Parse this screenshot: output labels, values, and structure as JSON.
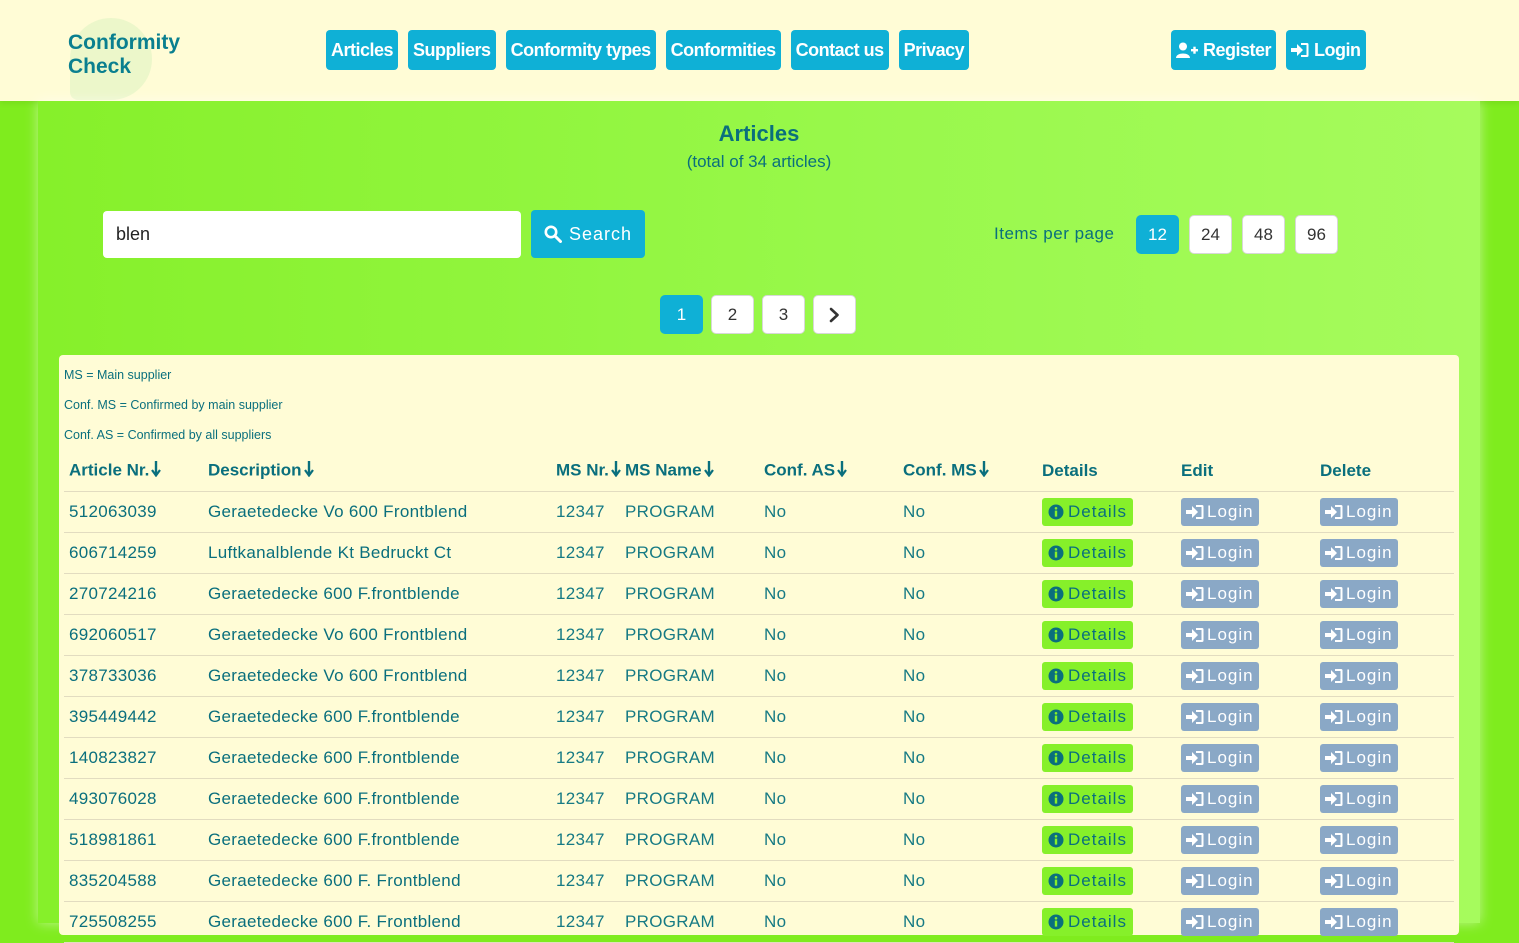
{
  "logo": {
    "line1": "Conformity",
    "line2": "Check"
  },
  "nav": [
    {
      "label": "Articles",
      "id": "articles"
    },
    {
      "label": "Suppliers",
      "id": "suppliers"
    },
    {
      "label": "Conformity types",
      "id": "conformity-types"
    },
    {
      "label": "Conformities",
      "id": "conformities"
    },
    {
      "label": "Contact us",
      "id": "contact-us"
    },
    {
      "label": "Privacy",
      "id": "privacy"
    }
  ],
  "auth": {
    "register_label": "Register",
    "register_icon": "user-plus-icon",
    "login_label": "Login",
    "login_icon": "sign-in-icon"
  },
  "page": {
    "title": "Articles",
    "subtitle": "(total of 34 articles)"
  },
  "search": {
    "value": "blen",
    "button_label": "Search",
    "icon": "search-icon"
  },
  "items_per_page": {
    "label": "Items per page",
    "options": [
      "12",
      "24",
      "48",
      "96"
    ],
    "selected": "12"
  },
  "pagination": {
    "pages": [
      "1",
      "2",
      "3"
    ],
    "current": "1",
    "next_icon": "chevron-right-icon"
  },
  "legend": [
    "MS = Main supplier",
    "Conf. MS = Confirmed by main supplier",
    "Conf. AS = Confirmed by all suppliers"
  ],
  "table": {
    "headers": [
      "Article Nr.",
      "Description",
      "MS Nr.",
      "MS Name",
      "Conf. AS",
      "Conf. MS",
      "Details",
      "Edit",
      "Delete"
    ],
    "sortable": [
      true,
      true,
      true,
      true,
      true,
      true,
      false,
      false,
      false
    ],
    "details_label": "Details",
    "details_icon": "info-circle-icon",
    "login_label": "Login",
    "rows": [
      {
        "article": "512063039",
        "description": "Geraetedecke Vo 600 Frontblend",
        "ms_nr": "12347",
        "ms_name": "PROGRAM",
        "conf_as": "No",
        "conf_ms": "No"
      },
      {
        "article": "606714259",
        "description": "Luftkanalblende Kt Bedruckt Ct",
        "ms_nr": "12347",
        "ms_name": "PROGRAM",
        "conf_as": "No",
        "conf_ms": "No"
      },
      {
        "article": "270724216",
        "description": "Geraetedecke 600 F.frontblende",
        "ms_nr": "12347",
        "ms_name": "PROGRAM",
        "conf_as": "No",
        "conf_ms": "No"
      },
      {
        "article": "692060517",
        "description": "Geraetedecke Vo 600 Frontblend",
        "ms_nr": "12347",
        "ms_name": "PROGRAM",
        "conf_as": "No",
        "conf_ms": "No"
      },
      {
        "article": "378733036",
        "description": "Geraetedecke Vo 600 Frontblend",
        "ms_nr": "12347",
        "ms_name": "PROGRAM",
        "conf_as": "No",
        "conf_ms": "No"
      },
      {
        "article": "395449442",
        "description": "Geraetedecke 600 F.frontblende",
        "ms_nr": "12347",
        "ms_name": "PROGRAM",
        "conf_as": "No",
        "conf_ms": "No"
      },
      {
        "article": "140823827",
        "description": "Geraetedecke 600 F.frontblende",
        "ms_nr": "12347",
        "ms_name": "PROGRAM",
        "conf_as": "No",
        "conf_ms": "No"
      },
      {
        "article": "493076028",
        "description": "Geraetedecke 600 F.frontblende",
        "ms_nr": "12347",
        "ms_name": "PROGRAM",
        "conf_as": "No",
        "conf_ms": "No"
      },
      {
        "article": "518981861",
        "description": "Geraetedecke 600 F.frontblende",
        "ms_nr": "12347",
        "ms_name": "PROGRAM",
        "conf_as": "No",
        "conf_ms": "No"
      },
      {
        "article": "835204588",
        "description": "Geraetedecke 600 F. Frontblend",
        "ms_nr": "12347",
        "ms_name": "PROGRAM",
        "conf_as": "No",
        "conf_ms": "No"
      },
      {
        "article": "725508255",
        "description": "Geraetedecke 600 F. Frontblend",
        "ms_nr": "12347",
        "ms_name": "PROGRAM",
        "conf_as": "No",
        "conf_ms": "No"
      }
    ]
  },
  "colors": {
    "header_bg": "#fffcd6",
    "accent": "#0fb0d6",
    "green": "#86f02a",
    "text": "#0a6f7d",
    "login_btn": "#8aa8c6"
  }
}
